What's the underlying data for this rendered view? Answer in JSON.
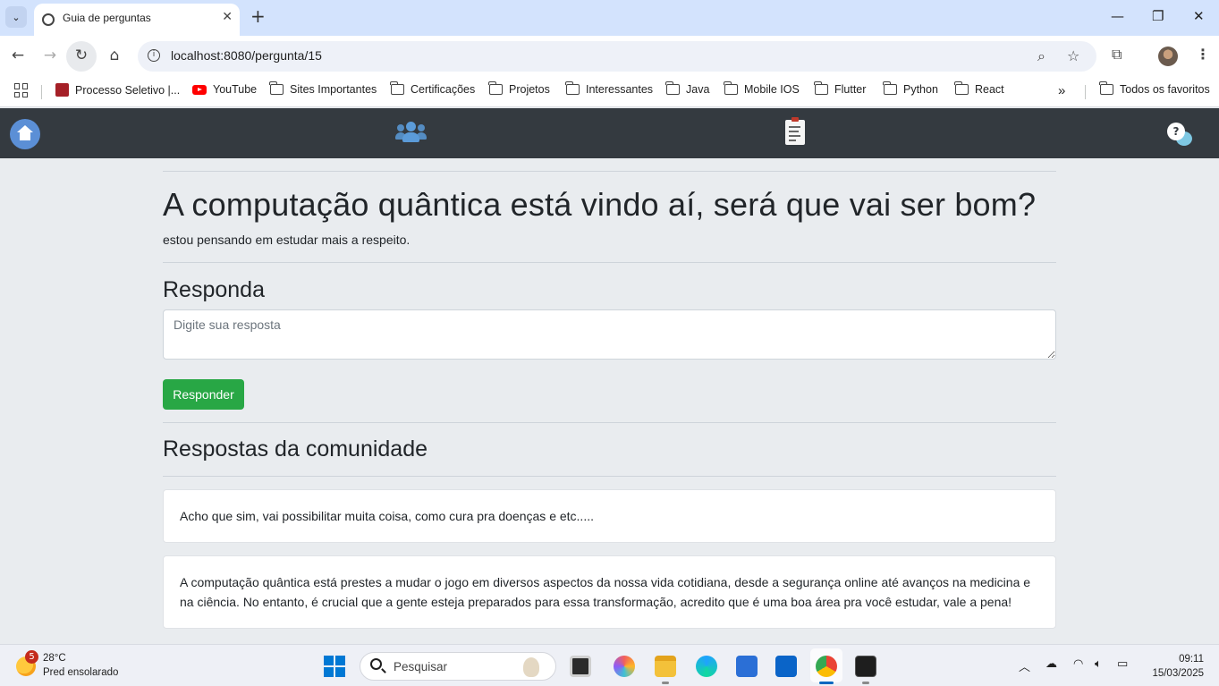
{
  "browser": {
    "tab_title": "Guia de perguntas",
    "url": "localhost:8080/pergunta/15",
    "bookmarks": [
      {
        "label": "Processo Seletivo |...",
        "icon": "processo-seletivo-icon"
      },
      {
        "label": "YouTube",
        "icon": "youtube-icon"
      },
      {
        "label": "Sites Importantes",
        "icon": "folder-icon"
      },
      {
        "label": "Certificações",
        "icon": "folder-icon"
      },
      {
        "label": "Projetos",
        "icon": "folder-icon"
      },
      {
        "label": "Interessantes",
        "icon": "folder-icon"
      },
      {
        "label": "Java",
        "icon": "folder-icon"
      },
      {
        "label": "Mobile IOS",
        "icon": "folder-icon"
      },
      {
        "label": "Flutter",
        "icon": "folder-icon"
      },
      {
        "label": "Python",
        "icon": "folder-icon"
      },
      {
        "label": "React",
        "icon": "folder-icon"
      }
    ],
    "all_bookmarks_label": "Todos os favoritos"
  },
  "navbar": {
    "icons": [
      "home-icon",
      "users-icon",
      "document-icon",
      "chat-help-icon"
    ]
  },
  "question": {
    "title": "A computação quântica está vindo aí, será que vai ser bom?",
    "description": "estou pensando em estudar mais a respeito."
  },
  "reply_form": {
    "heading": "Responda",
    "placeholder": "Digite sua resposta",
    "value": "",
    "submit_label": "Responder"
  },
  "community": {
    "heading": "Respostas da comunidade",
    "answers": [
      {
        "text": "Acho que sim, vai possibilitar muita coisa, como cura pra doenças e etc....."
      },
      {
        "text": "A computação quântica está prestes a mudar o jogo em diversos aspectos da nossa vida cotidiana, desde a segurança online até avanços na medicina e na ciência. No entanto, é crucial que a gente esteja preparados para essa transformação, acredito que é uma boa área pra você estudar, vale a pena!"
      }
    ]
  },
  "taskbar": {
    "weather_badge": "5",
    "weather_temp": "28°C",
    "weather_desc": "Pred ensolarado",
    "search_placeholder": "Pesquisar",
    "time": "09:11",
    "date": "15/03/2025"
  },
  "colors": {
    "navbar_bg": "#343a40",
    "page_bg": "#e9ecef",
    "success": "#28a745",
    "tabbar_bg": "#d3e3fd"
  }
}
